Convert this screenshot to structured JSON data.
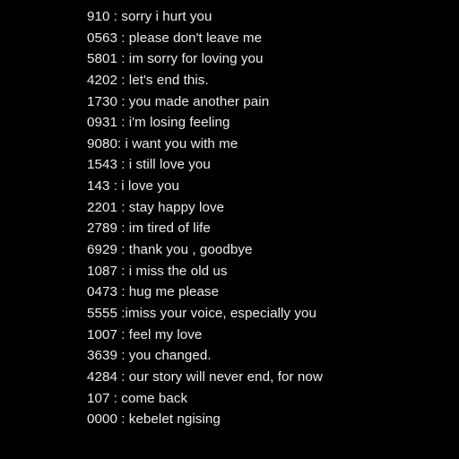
{
  "background_color": "#000000",
  "text_color": "#ececec",
  "lines": [
    "910 : sorry i hurt you",
    "0563 : please don't leave me",
    "5801 : im sorry for loving you",
    "4202 : let's end this.",
    "1730 : you made another pain",
    "0931 : i'm losing feeling",
    "9080: i want you with me",
    "1543 : i still love you",
    "143 : i love you",
    "2201 : stay happy love",
    "2789 : im tired of life",
    "6929 : thank you , goodbye",
    "1087 : i miss the old us",
    "0473 : hug me please",
    "5555 :imiss your voice, especially you",
    "1007 : feel my love",
    "3639 : you changed.",
    "4284 : our story will never end, for now",
    "107 : come back",
    "0000 : kebelet ngising"
  ]
}
